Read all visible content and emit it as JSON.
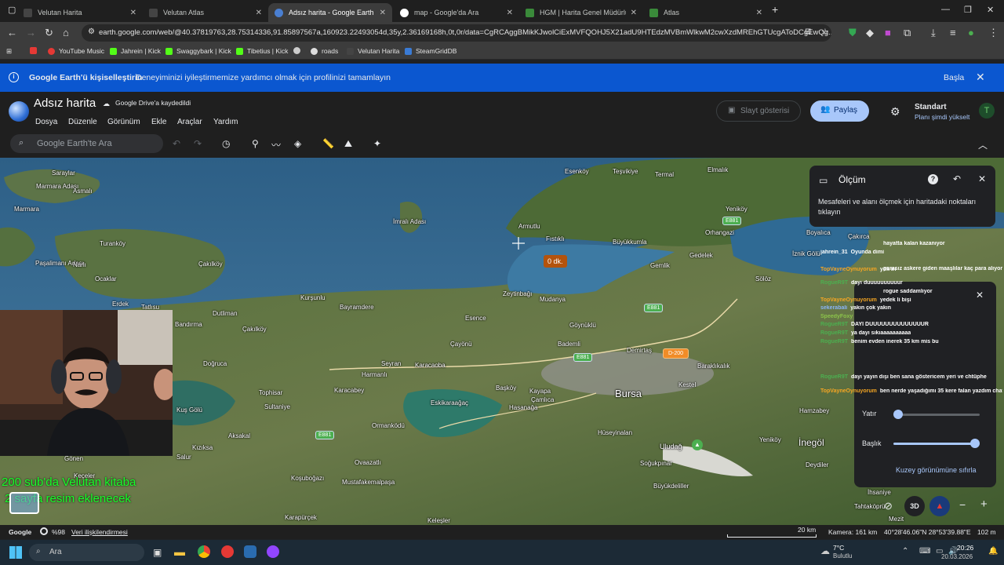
{
  "browser": {
    "tabs": [
      {
        "title": "Velutan Harita",
        "active": false
      },
      {
        "title": "Velutan Atlas",
        "active": false
      },
      {
        "title": "Adsız harita - Google Earth",
        "active": true
      },
      {
        "title": "map - Google'da Ara",
        "active": false
      },
      {
        "title": "HGM | Harita Genel Müdürlüğü",
        "active": false
      },
      {
        "title": "Atlas",
        "active": false
      }
    ],
    "url": "earth.google.com/web/@40.37819763,28.75314336,91.85897567a,160923.22493054d,35y,2.36169168h,0t,0r/data=CgRCAggBMikKJwolCiExMVFQOHJ5X21adU9HTEdzMVBmWlkwM2cwXzdMREhGTUcgAToDCgEwQg...",
    "bookmarks": [
      "YouTube Music",
      "Jahrein | Kick",
      "Swaggybark | Kick",
      "Tibetius | Kick",
      "roads",
      "Velutan Harita",
      "SteamGridDB"
    ]
  },
  "banner": {
    "title": "Google Earth'ü kişiselleştirin",
    "text": "Deneyiminizi iyileştirmemize yardımcı olmak için profilinizi tamamlayın",
    "action": "Başla"
  },
  "earth": {
    "doc_title": "Adsız harita",
    "saved": "Google Drive'a kaydedildi",
    "menus": [
      "Dosya",
      "Düzenle",
      "Görünüm",
      "Ekle",
      "Araçlar",
      "Yardım"
    ],
    "slideshow": "Slayt gösterisi",
    "share": "Paylaş",
    "plan": "Standart",
    "upgrade": "Planı şimdi yükselt",
    "search_placeholder": "Google Earth'te Ara"
  },
  "measure": {
    "title": "Ölçüm",
    "text": "Mesafeleri ve alanı ölçmek için haritadaki noktaları tıklayın",
    "tooltip": "0 dk."
  },
  "view_panel": {
    "tilt_label": "Yatır",
    "heading_label": "Başlık",
    "reset": "Kuzey görünümüne sıfırla",
    "tilt_level": 0.0,
    "heading_level": 1.0,
    "mode_3d": "3D"
  },
  "map_labels": {
    "places": [
      "Saraylar",
      "Marmara Adası",
      "Asmalı",
      "Marmara",
      "İmralı Adası",
      "Esenköy",
      "Teşvikiye",
      "Termal",
      "Elmalık",
      "Yeniköy",
      "Armutlu",
      "Fıstıklı",
      "Büyükkumla",
      "Orhangazi",
      "Boyalıca",
      "Çakırca",
      "İznik Gölü",
      "Turanköy",
      "Paşalimanı Adası",
      "Narlı",
      "Çakılköy",
      "Ocaklar",
      "Gemlik",
      "Gedelek",
      "Sölöz",
      "Erdek",
      "Tatlısu",
      "Kurşunlu",
      "Bayramdere",
      "Zeytinbağı",
      "Mudanya",
      "Dutliman",
      "Bandırma",
      "Esence",
      "Göynüklü",
      "Çakılköy",
      "Çayönü",
      "Bademli",
      "Demirtaş",
      "Doğruca",
      "Seyran",
      "Karacaoba",
      "Harmanlı",
      "Başköy",
      "Kayapa",
      "Çamlıca",
      "Baraklıkalık",
      "Kestel",
      "Bursa",
      "Tophisar",
      "Sultaniye",
      "Karacabey",
      "Eskikaraağaç",
      "Hasanağa",
      "Kuş Gölü",
      "Ormanködü",
      "Hüseyinalan",
      "Aksakal",
      "Kızıksa",
      "Salur",
      "Gönen",
      "Keçeler",
      "Ovaazatlı",
      "Mustafakemalpaşa",
      "Koşuboğazı",
      "Uludağ",
      "Soğukpınar",
      "Büyükdeliller",
      "Yeniköy",
      "İnegöl",
      "Hamzabey",
      "Deydiler",
      "Tahtaköprü",
      "Mezit",
      "İhsaniye",
      "Karapürçek",
      "Keleşler"
    ],
    "roads": [
      "E881",
      "E881",
      "E881",
      "E881",
      "D-200"
    ]
  },
  "chat": [
    {
      "user": "",
      "msg": "hayatta kalan kazanıyor",
      "color": "#ffffff"
    },
    {
      "user": "jahrein_31",
      "msg": "Oyunda dimi",
      "color": "#ffffff"
    },
    {
      "user": "",
      "msg": "parasız askere giden maaşlılar kaç para alıyor aylık",
      "color": "#ffffff"
    },
    {
      "user": "TopVayneOynuyorum",
      "msg": "yok iri",
      "color": "#f5a623"
    },
    {
      "user": "RogueR9T",
      "msg": "dayı duuuuuuuuuur",
      "color": "#4caf50"
    },
    {
      "user": "",
      "msg": "rogue saddamlıyor",
      "color": "#ffffff"
    },
    {
      "user": "TopVayneOynuyorum",
      "msg": "yedek li bişi",
      "color": "#f5a623"
    },
    {
      "user": "sekerabali",
      "msg": "yakın çok yakın",
      "color": "#8ab4f8"
    },
    {
      "user": "SpeedyFoxy",
      "msg": "",
      "color": "#8bc34a"
    },
    {
      "user": "RogueR9T",
      "msg": "DAYI DUUUUUUUUUUUUUUR",
      "color": "#4caf50"
    },
    {
      "user": "RogueR9T",
      "msg": "ya dayı sıkıaaaaaaaaaa",
      "color": "#4caf50"
    },
    {
      "user": "RogueR9T",
      "msg": "benim evden inerek 35 km mis bu",
      "color": "#4caf50"
    },
    {
      "user": "RogueR9T",
      "msg": "dayı yayın dışı ben sana göstericem yeri ve chtüphe",
      "color": "#4caf50"
    },
    {
      "user": "TopVayneOynuyorum",
      "msg": "ben nerde yaşadığımı 35 kere falan yazdım chate",
      "color": "#f5a623"
    }
  ],
  "overlay_text": [
    "200 sub'da Velutan kitaba",
    "2 sayfa resim eklenecek"
  ],
  "statusbar": {
    "brand": "Google",
    "percent": "%98",
    "data_link": "Veri ilişkilendirmesi",
    "scale": "20 km",
    "camera": "Kamera: 161 km",
    "coords": "40°28'46.06\"N 28°53'39.88\"E",
    "elevation": "102 m"
  },
  "taskbar": {
    "search": "Ara",
    "weather_temp": "7°C",
    "weather_text": "Bulutlu",
    "time": "20:26",
    "date": "20.03.2026"
  },
  "colors": {
    "sea": "#3b6f95",
    "land": "#4f6a3a",
    "banner": "#0b57d0",
    "accent": "#a8c7fa"
  }
}
